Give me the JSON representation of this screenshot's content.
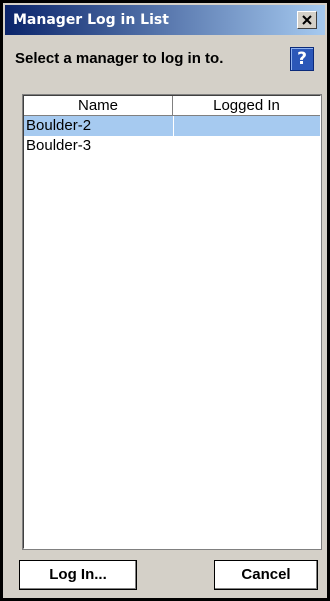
{
  "window": {
    "title": "Manager Log in List"
  },
  "prompt": "Select a manager to log in to.",
  "help_icon": "?",
  "table": {
    "columns": [
      "Name",
      "Logged In"
    ],
    "rows": [
      {
        "name": "Boulder-2",
        "logged_in": "",
        "selected": true
      },
      {
        "name": "Boulder-3",
        "logged_in": "",
        "selected": false
      }
    ]
  },
  "buttons": {
    "login": "Log In...",
    "cancel": "Cancel"
  },
  "colors": {
    "titlebar_start": "#0a246a",
    "titlebar_end": "#a6caf0",
    "selection": "#a6caf0",
    "dialog_bg": "#d4d0c8",
    "help_blue": "#2b57b8"
  }
}
